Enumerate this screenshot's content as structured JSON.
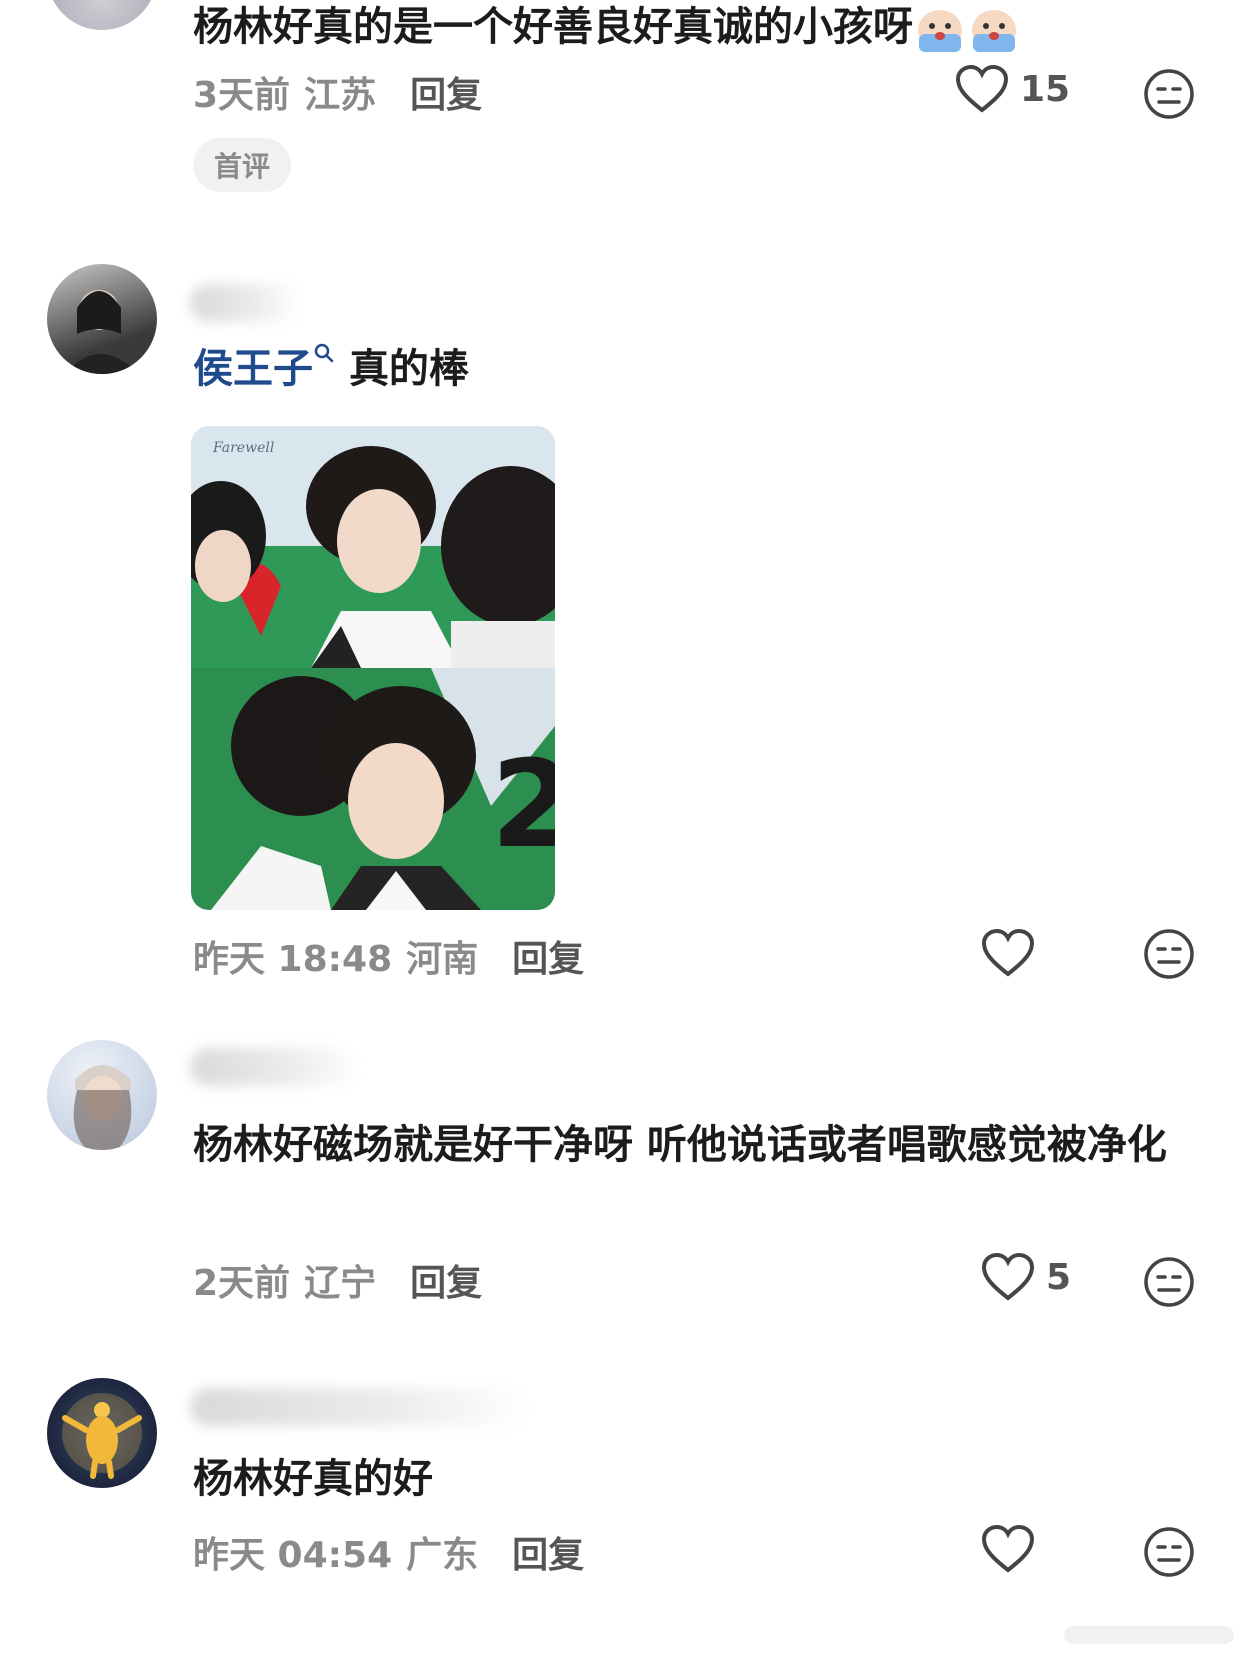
{
  "comments": [
    {
      "text": "杨林好真的是一个好善良好真诚的小孩呀",
      "time": "3天前",
      "region": "江苏",
      "reply": "回复",
      "likes": "15",
      "badge": "首评"
    },
    {
      "mention": "侯王子",
      "text": "真的棒",
      "time": "昨天 18:48",
      "region": "河南",
      "reply": "回复",
      "likes": "",
      "image_caption": "Farewell"
    },
    {
      "text": "杨林好磁场就是好干净呀 听他说话或者唱歌感觉被净化",
      "time": "2天前",
      "region": "辽宁",
      "reply": "回复",
      "likes": "5"
    },
    {
      "text": "杨林好真的好",
      "time": "昨天 04:54",
      "region": "广东",
      "reply": "回复",
      "likes": ""
    }
  ],
  "colors": {
    "meta": "#8a8a8a",
    "mention": "#1f4a8c",
    "text": "#1c1c1c"
  },
  "icons": {
    "like": "heart-outline-icon",
    "dislike": "meh-face-icon",
    "search": "search-icon"
  }
}
